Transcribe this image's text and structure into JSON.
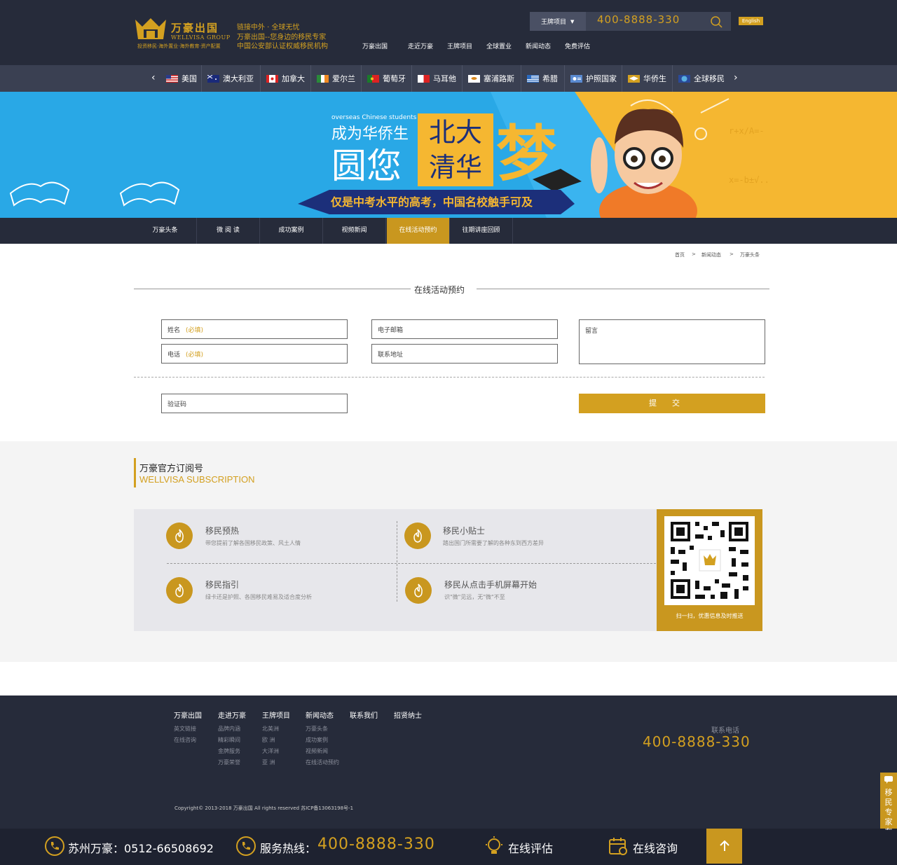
{
  "header": {
    "logo_cn": "万豪出国",
    "logo_en": "WELLVISA GROUP",
    "logo_sub": "投资移民·海外置业·海外教育·资产配置",
    "slogans": [
      "链接中外 · 全球无忧",
      "万豪出国--您身边的移民专家",
      "中国公安部认证权威移民机构"
    ],
    "search_select": "王牌项目",
    "search_phone": "400-8888-330",
    "english_btn": "English",
    "nav": [
      "万豪出国",
      "走近万豪",
      "王牌项目",
      "全球置业",
      "新闻动态",
      "免费评估"
    ]
  },
  "countries": [
    {
      "name": "美国",
      "flag": "us"
    },
    {
      "name": "澳大利亚",
      "flag": "au"
    },
    {
      "name": "加拿大",
      "flag": "ca"
    },
    {
      "name": "爱尔兰",
      "flag": "ie"
    },
    {
      "name": "葡萄牙",
      "flag": "pt"
    },
    {
      "name": "马耳他",
      "flag": "mt"
    },
    {
      "name": "塞浦路斯",
      "flag": "cy"
    },
    {
      "name": "希腊",
      "flag": "gr"
    },
    {
      "name": "护照国家",
      "flag": "passport"
    },
    {
      "name": "华侨生",
      "flag": "grad"
    },
    {
      "name": "全球移民",
      "flag": "globe"
    }
  ],
  "banner": {
    "en": "overseas Chinese students",
    "line1": "成为华侨生",
    "line2": "圆您",
    "box1": "北大",
    "box2": "清华",
    "dream": "梦",
    "ribbon": "仅是中考水平的高考，中国名校触手可及"
  },
  "subnav": [
    "万豪头条",
    "微 阅 读",
    "成功案例",
    "视频新闻",
    "在线活动预约",
    "往期讲座回顾"
  ],
  "breadcrumb": [
    "首页",
    ">",
    "新闻动态",
    ">",
    "万豪头条"
  ],
  "form": {
    "title": "在线活动预约",
    "name": "姓名",
    "phone": "电话",
    "required": "(必填)",
    "email": "电子邮箱",
    "address": "联系地址",
    "message": "留言",
    "captcha": "验证码",
    "submit": "提交"
  },
  "subscription": {
    "title_cn": "万豪官方订阅号",
    "title_en": "WELLVISA  SUBSCRIPTION",
    "items": [
      {
        "title": "移民预热",
        "desc": "带您提前了解各国移民政策、风土人情"
      },
      {
        "title": "移民小贴士",
        "desc": "踏出国门所需要了解的各种东到西方差异"
      },
      {
        "title": "移民指引",
        "desc": "绿卡还是护照、各国移民难易及适合度分析"
      },
      {
        "title": "移民从点击手机屏幕开始",
        "desc": "识\"微\"见远，无\"微\"不至"
      }
    ],
    "qr_caption": "扫一扫，优惠信息及时推送"
  },
  "footer": {
    "cols": [
      {
        "head": "万豪出国",
        "links": [
          "英文链接",
          "在线咨询"
        ]
      },
      {
        "head": "走进万豪",
        "links": [
          "品牌内涵",
          "精彩瞬间",
          "金牌服务",
          "万豪荣誉"
        ]
      },
      {
        "head": "王牌项目",
        "links": [
          "北美洲",
          "欧  洲",
          "大洋洲",
          "亚  洲"
        ]
      },
      {
        "head": "新闻动态",
        "links": [
          "万豪头条",
          "成功案例",
          "视频新闻",
          "在线活动预约"
        ]
      },
      {
        "head": "联系我们",
        "links": []
      },
      {
        "head": "招贤纳士",
        "links": []
      }
    ],
    "tel_label": "联系电话",
    "tel": "400-8888-330",
    "copyright": "Copyright© 2013-2018   万豪出国    All rights reserved    苏ICP备13063198号-1"
  },
  "bottom_bar": {
    "suzhou": "苏州万豪：0512-66508692",
    "hotline_label": "服务热线：",
    "hotline": "400-8888-330",
    "assess": "在线评估",
    "consult": "在线咨询"
  },
  "side_tab": {
    "label": "移民专家在线"
  },
  "colors": {
    "gold": "#d3a020",
    "navy": "#262b3a",
    "banner_blue": "#29a8e6",
    "banner_yellow": "#f5b731"
  }
}
